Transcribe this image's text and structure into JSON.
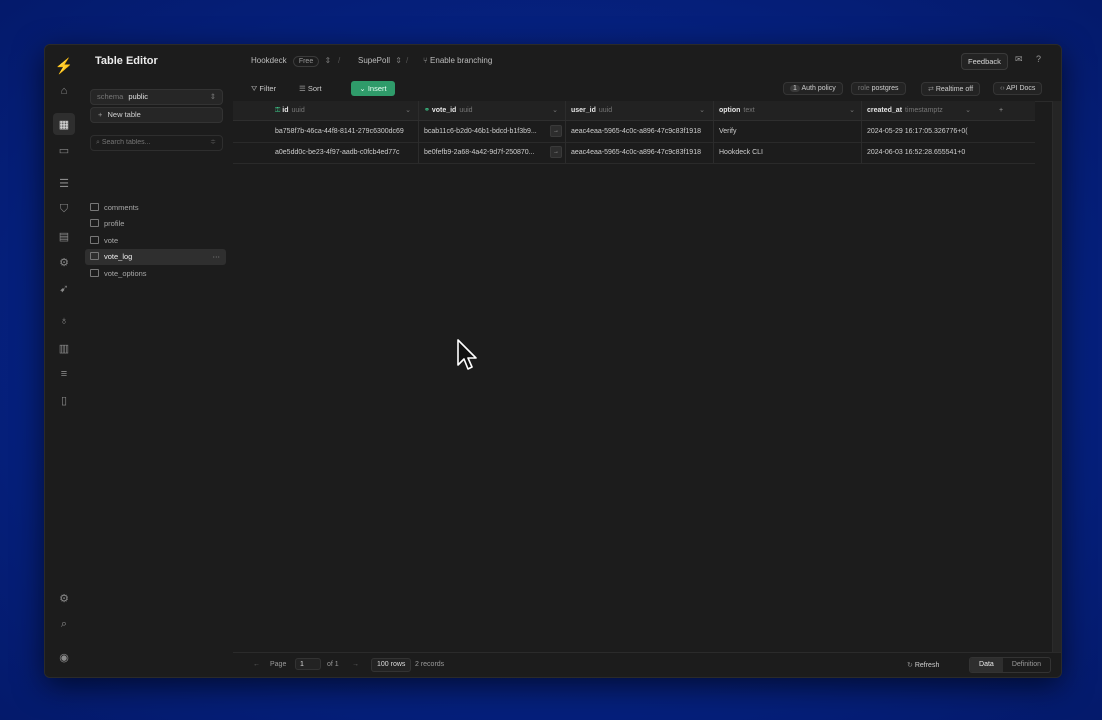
{
  "header": {
    "title": "Table Editor",
    "org": "Hookdeck",
    "plan": "Free",
    "project": "SupePoll",
    "branching": "Enable branching",
    "feedback": "Feedback"
  },
  "sidebar": {
    "schema_label": "schema",
    "schema_value": "public",
    "new_table": "New table",
    "search_placeholder": "Search tables...",
    "tables": [
      "comments",
      "profile",
      "vote",
      "vote_log",
      "vote_options"
    ],
    "active_table": "vote_log"
  },
  "toolbar": {
    "filter": "Filter",
    "sort": "Sort",
    "insert": "Insert",
    "auth_count": "1",
    "auth_policy": "Auth policy",
    "role_label": "role",
    "role_value": "postgres",
    "realtime": "Realtime off",
    "api_docs": "API Docs"
  },
  "columns": [
    {
      "name": "id",
      "type": "uuid"
    },
    {
      "name": "vote_id",
      "type": "uuid"
    },
    {
      "name": "user_id",
      "type": "uuid"
    },
    {
      "name": "option",
      "type": "text"
    },
    {
      "name": "created_at",
      "type": "timestamptz"
    }
  ],
  "rows": [
    {
      "id": "ba758f7b-46ca-44f8-8141-279c6300dc69",
      "vote_id": "bcab11c6-b2d0-46b1-bdcd-b1f3b9...",
      "user_id": "aeac4eaa-5965-4c0c-a896-47c9c83f1918",
      "option": "Verify",
      "created_at": "2024-05-29 16:17:05.326776+0("
    },
    {
      "id": "a0e5dd0c-be23-4f97-aadb-c0fcb4ed77c",
      "vote_id": "be0fefb9-2a68-4a42-9d7f-250870...",
      "user_id": "aeac4eaa-5965-4c0c-a896-47c9c83f1918",
      "option": "Hookdeck CLI",
      "created_at": "2024-06-03 16:52:28.655541+0"
    }
  ],
  "footer": {
    "page_label": "Page",
    "page_value": "1",
    "of": "of 1",
    "rows": "100 rows",
    "records": "2 records",
    "refresh": "Refresh",
    "data": "Data",
    "definition": "Definition"
  },
  "colors": {
    "accent": "#3ecf8e",
    "insert_button": "#2f9b6a",
    "background": "#1c1c1c",
    "desktop": "#062283"
  }
}
